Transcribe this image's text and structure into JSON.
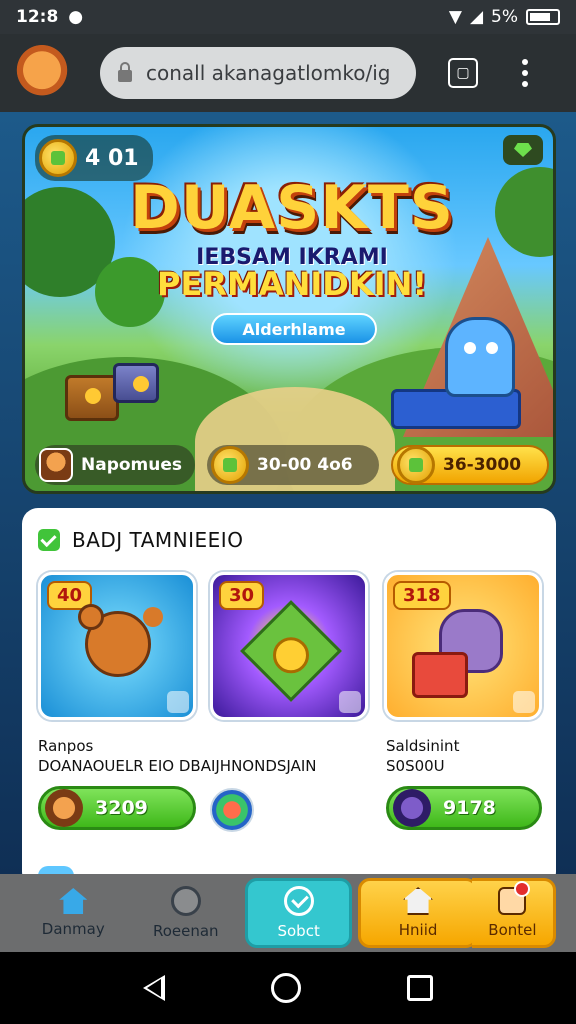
{
  "status_bar": {
    "time": "12:8",
    "battery": "5%"
  },
  "browser": {
    "url": "conall akanagatlomko/ig"
  },
  "hero": {
    "coin_count": "4 01",
    "title": "DUASKTS",
    "subtitle_line1": "IEBSAM IKRAMI",
    "subtitle_line2": "PERMANIDKIN!",
    "cta_label": "Alderhlame",
    "player_name": "Napomues",
    "player_score": "30-00 4o6",
    "reward_amount": "36-3000"
  },
  "section": {
    "title": "BADJ TAMNIEEIO",
    "cards": [
      {
        "badge": "40"
      },
      {
        "badge": "30"
      },
      {
        "badge": "318"
      }
    ],
    "left_meta": {
      "line1": "Ranpos",
      "line2": "DOANAOUELR EIO DBAIJHNONDSJAIN"
    },
    "right_meta": {
      "line1": "Saldsinint",
      "line2": "S0S00U"
    },
    "prices": [
      "3209",
      "9178"
    ]
  },
  "bottom_nav": [
    {
      "label": "Danmay"
    },
    {
      "label": "Roeenan"
    },
    {
      "label": "Sobct"
    },
    {
      "label": "Hniid"
    },
    {
      "label": "Bontel"
    }
  ],
  "colors": {
    "accent_teal": "#34c7cf",
    "accent_gold": "#f6a700",
    "accent_green": "#3fb81a"
  }
}
